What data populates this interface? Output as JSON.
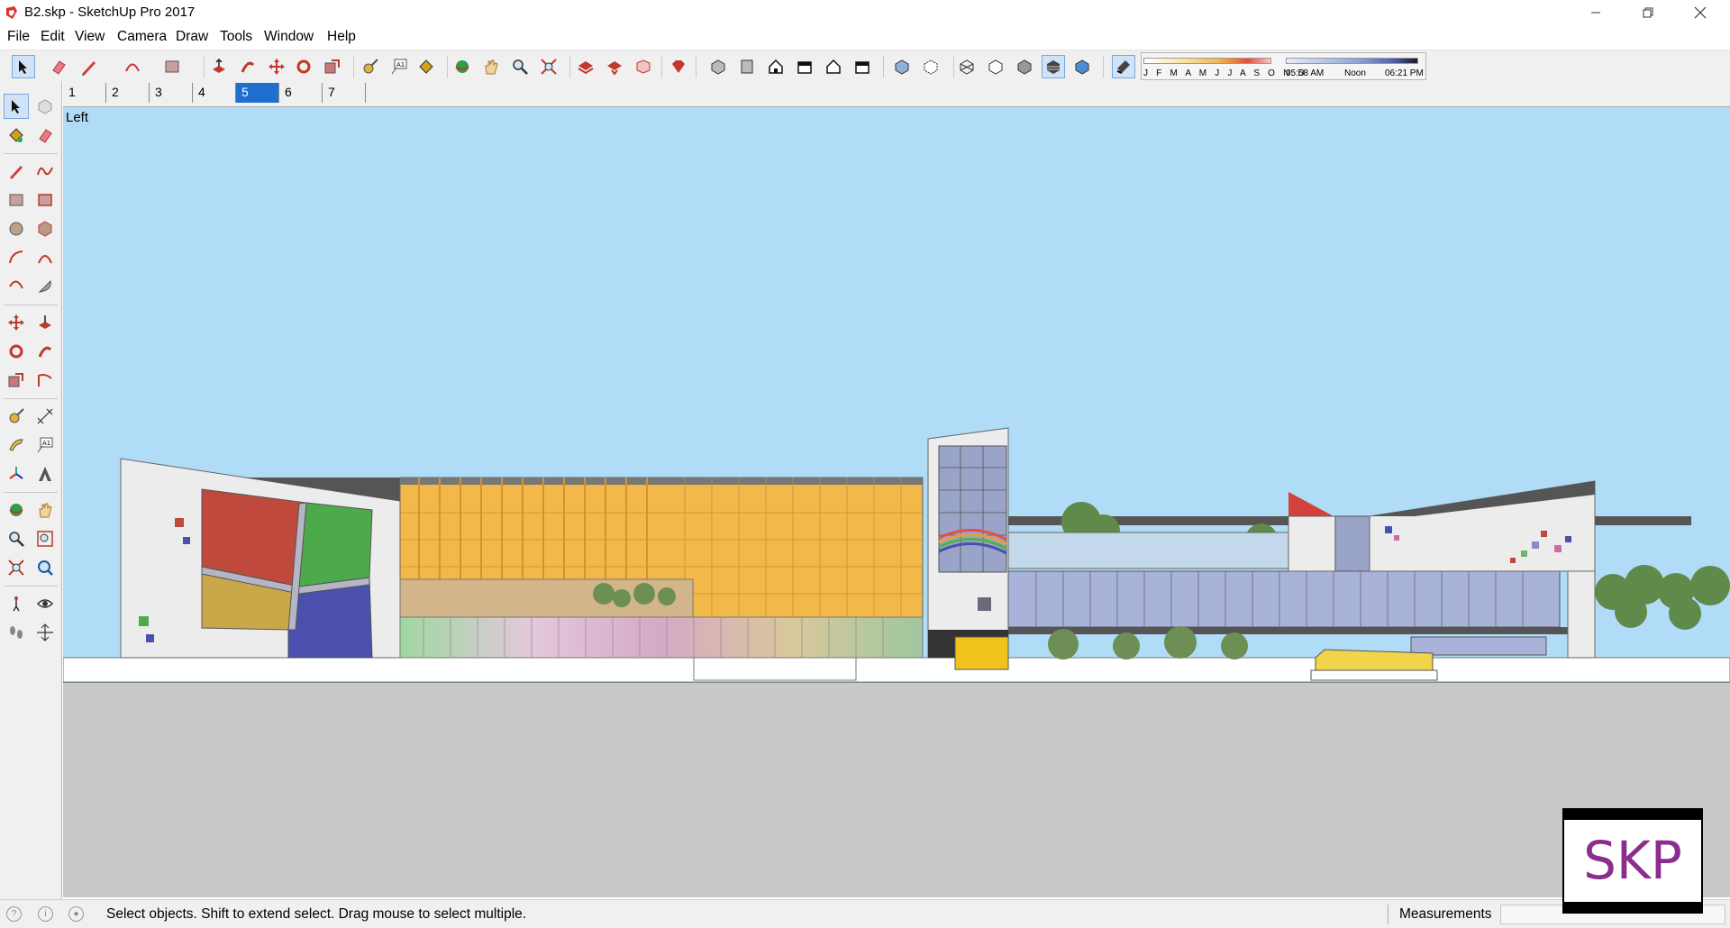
{
  "window": {
    "title": "B2.skp - SketchUp Pro 2017",
    "app_icon": "sketchup-logo-icon",
    "controls": {
      "minimize": "minimize-icon",
      "restore": "restore-icon",
      "close": "close-icon"
    }
  },
  "menu": {
    "items": [
      "File",
      "Edit",
      "View",
      "Camera",
      "Draw",
      "Tools",
      "Window",
      "Help"
    ]
  },
  "toolbar": {
    "shadow_settings": {
      "months": "J F M A M J J A S O N D",
      "time_start": "05:58 AM",
      "time_mid": "Noon",
      "time_end": "06:21 PM"
    }
  },
  "scenes": {
    "tabs": [
      "1",
      "2",
      "3",
      "4",
      "5",
      "6",
      "7"
    ],
    "active_index": 4
  },
  "viewport": {
    "view_label": "Left",
    "colors": {
      "sky": "#b0dcf7",
      "ground": "#c9c9c9",
      "horizon_line": "#3a9a3a",
      "accent_orange": "#f2b84a"
    }
  },
  "status": {
    "message": "Select objects. Shift to extend select. Drag mouse to select multiple.",
    "measurements_label": "Measurements",
    "measurements_value": ""
  },
  "watermark": {
    "text": "SKP"
  }
}
